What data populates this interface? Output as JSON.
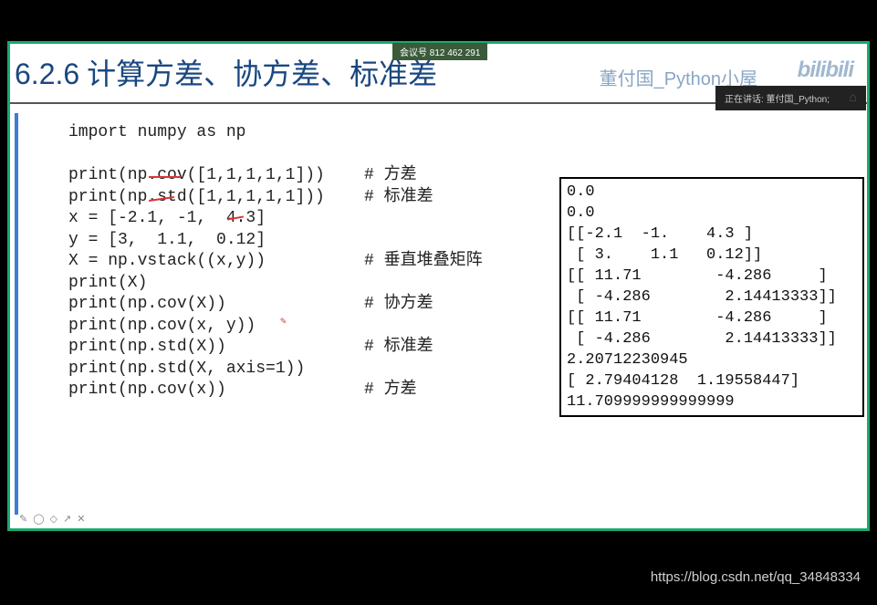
{
  "meeting_id": "会议号 812 462 291",
  "section_number": "6.2.6",
  "section_title": "计算方差、协方差、标准差",
  "author": "董付国_Python小屋",
  "logo": "bilibili",
  "now_playing_label": "正在讲话: 董付国_Python;",
  "code": {
    "lines": [
      "import numpy as np",
      "",
      "print(np.cov([1,1,1,1,1]))",
      "print(np.std([1,1,1,1,1]))",
      "x = [-2.1, -1,  4.3]",
      "y = [3,  1.1,  0.12]",
      "X = np.vstack((x,y))",
      "print(X)",
      "print(np.cov(X))",
      "print(np.cov(x, y))",
      "print(np.std(X))",
      "print(np.std(X, axis=1))",
      "print(np.cov(x))"
    ],
    "comments": {
      "2": "# 方差",
      "3": "# 标准差",
      "6": "# 垂直堆叠矩阵",
      "8": "# 协方差",
      "10": "# 标准差",
      "12": "# 方差"
    }
  },
  "output": [
    "0.0",
    "0.0",
    "[[-2.1  -1.    4.3 ]",
    " [ 3.    1.1   0.12]]",
    "[[ 11.71        -4.286     ]",
    " [ -4.286        2.14413333]]",
    "[[ 11.71        -4.286     ]",
    " [ -4.286        2.14413333]]",
    "2.20712230945",
    "[ 2.79404128  1.19558447]",
    "11.709999999999999"
  ],
  "watermark": "https://blog.csdn.net/qq_34848334",
  "comment_col": 30
}
